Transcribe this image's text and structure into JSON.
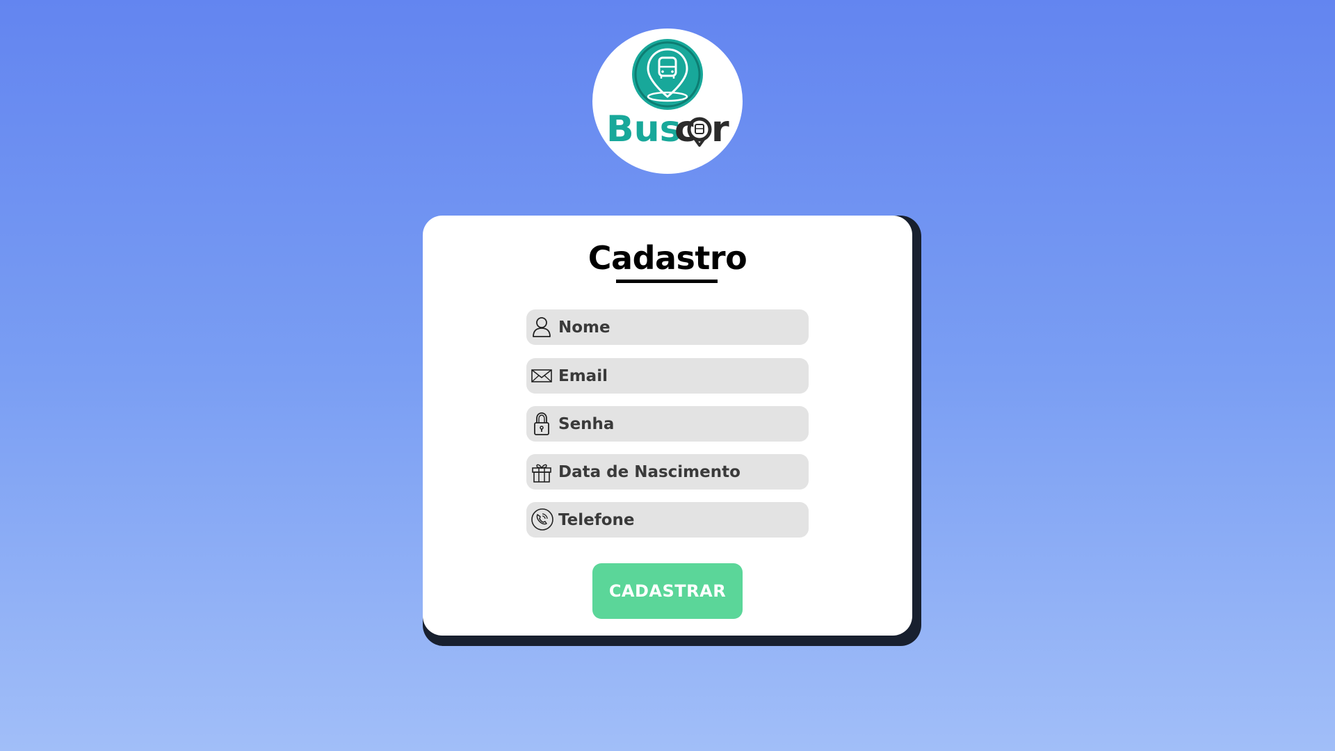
{
  "logo": {
    "text_part1": "Bus",
    "text_part2": "c",
    "text_part3": "r",
    "brand_color": "#18a89a",
    "dark_color": "#2b2b2b"
  },
  "form": {
    "title": "Cadastro",
    "fields": [
      {
        "name": "nome",
        "placeholder": "Nome",
        "icon": "user-icon",
        "type": "text"
      },
      {
        "name": "email",
        "placeholder": "Email",
        "icon": "envelope-icon",
        "type": "email"
      },
      {
        "name": "senha",
        "placeholder": "Senha",
        "icon": "lock-icon",
        "type": "password"
      },
      {
        "name": "data-nascimento",
        "placeholder": "Data de Nascimento",
        "icon": "gift-icon",
        "type": "text"
      },
      {
        "name": "telefone",
        "placeholder": "Telefone",
        "icon": "phone-icon",
        "type": "tel"
      }
    ],
    "submit_label": "CADASTRAR",
    "submit_color": "#5bd699"
  },
  "colors": {
    "background_top": "#6385f0",
    "background_bottom": "#a1bef8",
    "card": "#ffffff",
    "card_shadow": "#18202f",
    "field_bg": "#e3e3e3"
  }
}
